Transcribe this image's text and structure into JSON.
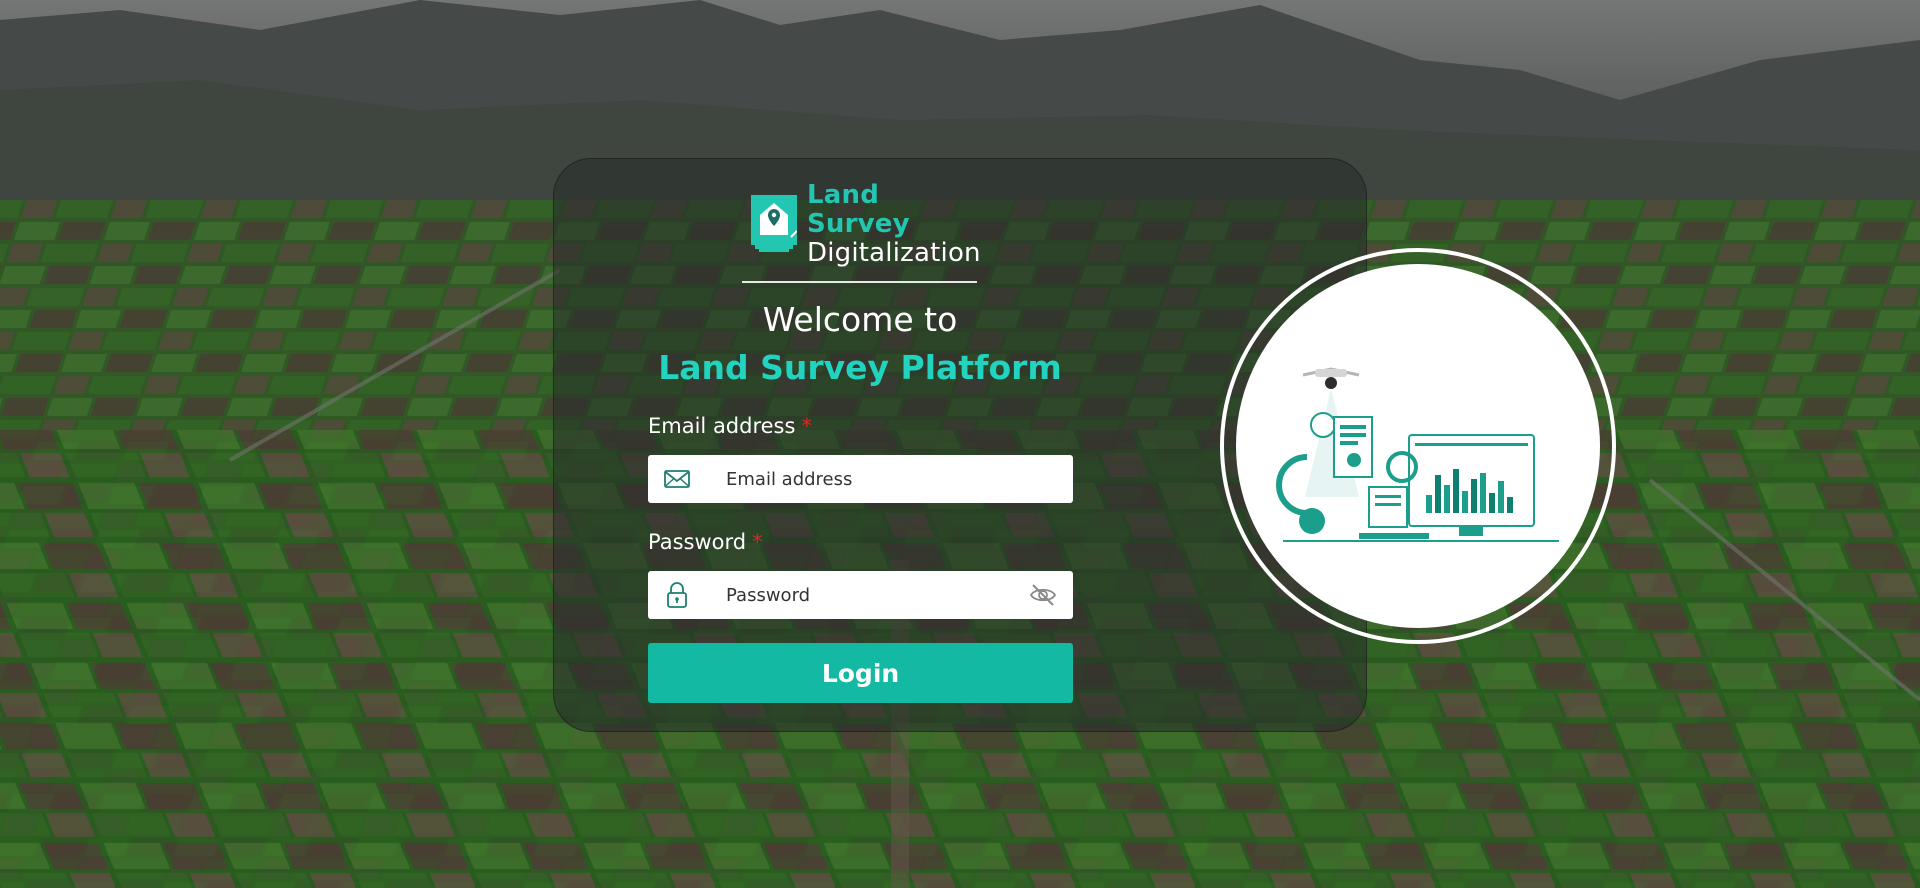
{
  "brand": {
    "name_line1": "Land Survey",
    "name_line2": "Digitalization"
  },
  "welcome": {
    "line1": "Welcome to",
    "line2": "Land Survey Platform"
  },
  "form": {
    "email": {
      "label": "Email address",
      "required_mark": "*",
      "placeholder": "Email address",
      "value": ""
    },
    "password": {
      "label": "Password",
      "required_mark": "*",
      "placeholder": "Password",
      "value": ""
    },
    "login_label": "Login"
  },
  "icons": {
    "email": "envelope-icon",
    "password": "lock-icon",
    "visibility": "eye-off-icon"
  },
  "colors": {
    "accent": "#13b9a3",
    "heading_accent": "#22d3c0",
    "required": "#e02424"
  }
}
